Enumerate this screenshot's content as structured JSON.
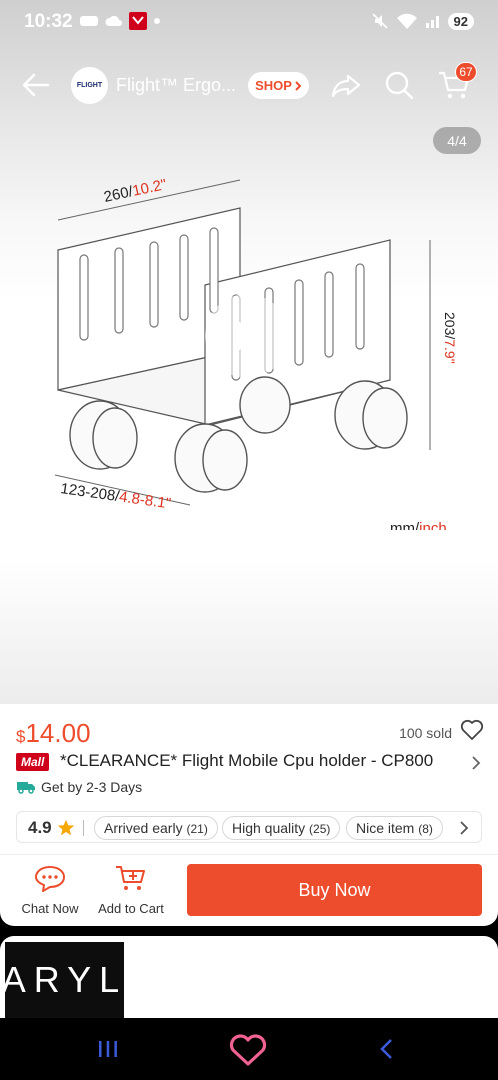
{
  "status_bar": {
    "time": "10:32",
    "battery": "92"
  },
  "topnav": {
    "store_logo_text": "FLIGHT",
    "store_name": "Flight™ Ergo...",
    "shop_label": "SHOP",
    "cart_count": "67"
  },
  "gallery": {
    "counter": "4/4",
    "diagram": {
      "width_dim": "260/",
      "width_dim_inch": "10.2\"",
      "height_dim": "203/",
      "height_dim_inch": "7.9\"",
      "adjust_dim": "123-208/",
      "adjust_dim_inch": "4.8-8.1\"",
      "units_mm": "mm/",
      "units_inch": "inch"
    }
  },
  "product": {
    "currency": "$",
    "price": "14.00",
    "sold": "100 sold",
    "mall_badge": "Mall",
    "title": "*CLEARANCE*  Flight Mobile Cpu holder - CP800",
    "delivery": "Get by 2-3 Days",
    "rating": "4.9",
    "review_tags": [
      {
        "label": "Arrived early",
        "count": "(21)"
      },
      {
        "label": "High quality",
        "count": "(25)"
      },
      {
        "label": "Nice item",
        "count": "(8)"
      }
    ]
  },
  "actions": {
    "chat_label": "Chat Now",
    "add_to_cart_label": "Add to Cart",
    "buy_now_label": "Buy Now"
  },
  "promo": {
    "brand": "ARYL"
  },
  "colors": {
    "accent": "#ee4d2d",
    "mall": "#d0011b",
    "star": "#f6a700"
  }
}
